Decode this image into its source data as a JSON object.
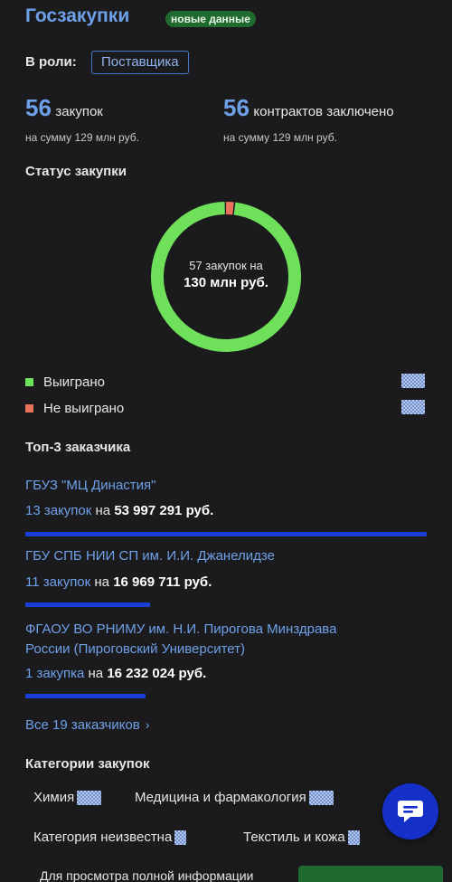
{
  "header": {
    "title": "Госзакупки",
    "badge": "новые данные"
  },
  "role": {
    "label": "В роли:",
    "value": "Поставщика"
  },
  "stats": [
    {
      "number": "56",
      "label": "закупок",
      "sub": "на сумму 129 млн руб."
    },
    {
      "number": "56",
      "label": "контрактов заключено",
      "sub": "на сумму 129 млн руб."
    }
  ],
  "status": {
    "heading": "Статус закупки",
    "center_line1": "57 закупок на",
    "center_line2": "130 млн руб.",
    "won_fraction": 0.98,
    "lost_fraction": 0.02,
    "won_color": "#6ee05a",
    "lost_color": "#e8735a",
    "legend": [
      {
        "label": "Выиграно",
        "color": "#6ee05a"
      },
      {
        "label": "Не выиграно",
        "color": "#e8735a"
      }
    ]
  },
  "top_customers": {
    "heading": "Топ-3 заказчика",
    "items": [
      {
        "name": "ГБУЗ \"МЦ Династия\"",
        "count": "13 закупок",
        "on": "на",
        "sum": "53 997 291 руб.",
        "share": 1.0
      },
      {
        "name": "ГБУ СПБ НИИ СП им. И.И. Джанелидзе",
        "count": "11 закупок",
        "on": "на",
        "sum": "16 969 711 руб.",
        "share": 0.31
      },
      {
        "name_line1": "ФГАОУ ВО РНИМУ им. Н.И. Пирогова Минздрава",
        "name_line2": "России (Пироговский Университет)",
        "count": "1 закупка",
        "on": "на",
        "sum": "16 232 024 руб.",
        "share": 0.3
      }
    ],
    "all_link": "Все 19 заказчиков"
  },
  "categories": {
    "heading": "Категории закупок",
    "chips": [
      "Химия",
      "Медицина и фармакология",
      "Категория неизвестна",
      "Текстиль и кожа"
    ]
  },
  "footer": {
    "text": "Для просмотра полной информации"
  },
  "icons": {
    "fab": "chat-icon",
    "chevron": "chevron-right-icon"
  }
}
